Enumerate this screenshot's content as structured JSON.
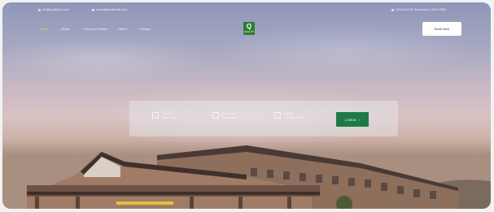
{
  "topbar": {
    "email": "info@quality-inn.com",
    "phone": "reservations@hotel.com",
    "address": "1234 Hotel St, Somewhere, USA 12345"
  },
  "nav": {
    "items": [
      "Home",
      "About",
      "Rooms & Suites",
      "Offers",
      "Contact"
    ],
    "active_index": 0
  },
  "logo": {
    "letter": "Q",
    "text": "QUALITY"
  },
  "book_button": "Book Now",
  "search": {
    "checkin": {
      "label": "Check in",
      "value": "Select Date"
    },
    "checkout": {
      "label": "Check out",
      "value": "Select Date"
    },
    "guests": {
      "label": "Guests",
      "value": "2 Adults, 1 Room"
    },
    "button": "CHECK"
  },
  "colors": {
    "accent": "#1e7a45",
    "active_nav": "#e8d36a"
  }
}
